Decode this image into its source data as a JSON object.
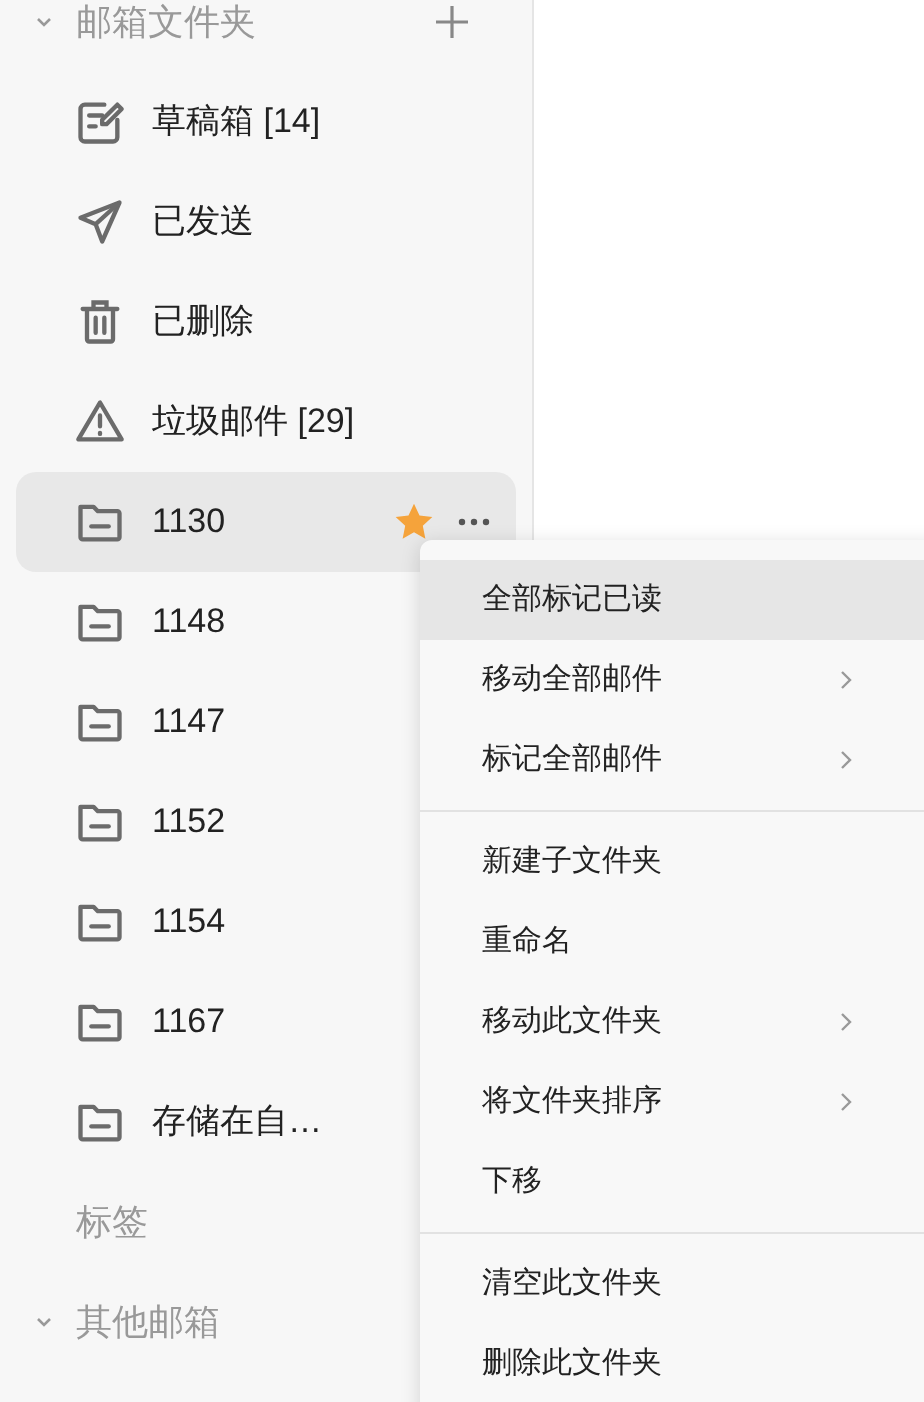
{
  "folders_section": {
    "title": "邮箱文件夹",
    "expanded": true
  },
  "folders": [
    {
      "kind": "drafts",
      "label": "草稿箱 [14]",
      "selected": false,
      "starred": false
    },
    {
      "kind": "sent",
      "label": "已发送",
      "selected": false,
      "starred": false
    },
    {
      "kind": "trash",
      "label": "已删除",
      "selected": false,
      "starred": false
    },
    {
      "kind": "spam",
      "label": "垃圾邮件 [29]",
      "selected": false,
      "starred": false
    },
    {
      "kind": "folder",
      "label": "1130",
      "selected": true,
      "starred": true
    },
    {
      "kind": "folder",
      "label": "1148",
      "selected": false,
      "starred": false
    },
    {
      "kind": "folder",
      "label": "1147",
      "selected": false,
      "starred": false
    },
    {
      "kind": "folder",
      "label": "1152",
      "selected": false,
      "starred": false
    },
    {
      "kind": "folder",
      "label": "1154",
      "selected": false,
      "starred": false
    },
    {
      "kind": "folder",
      "label": "1167",
      "selected": false,
      "starred": false
    },
    {
      "kind": "folder",
      "label": "存储在自…",
      "selected": false,
      "starred": false
    }
  ],
  "tags_section": {
    "title": "标签"
  },
  "other_section": {
    "title": "其他邮箱",
    "expanded": true
  },
  "context_menu": [
    [
      {
        "label": "全部标记已读",
        "submenu": false,
        "selected": true
      },
      {
        "label": "移动全部邮件",
        "submenu": true,
        "selected": false
      },
      {
        "label": "标记全部邮件",
        "submenu": true,
        "selected": false
      }
    ],
    [
      {
        "label": "新建子文件夹",
        "submenu": false,
        "selected": false
      },
      {
        "label": "重命名",
        "submenu": false,
        "selected": false
      },
      {
        "label": "移动此文件夹",
        "submenu": true,
        "selected": false
      },
      {
        "label": "将文件夹排序",
        "submenu": true,
        "selected": false
      },
      {
        "label": "下移",
        "submenu": false,
        "selected": false
      }
    ],
    [
      {
        "label": "清空此文件夹",
        "submenu": false,
        "selected": false
      },
      {
        "label": "删除此文件夹",
        "submenu": false,
        "selected": false
      }
    ]
  ]
}
